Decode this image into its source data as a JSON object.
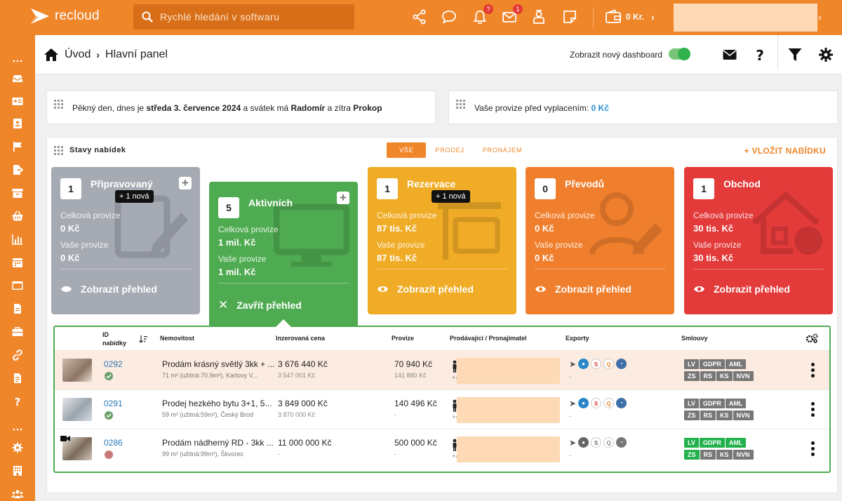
{
  "app": {
    "logo_text": "recloud"
  },
  "topbar": {
    "search_placeholder": "Rychlé hledání v softwaru",
    "notifications_count": "?",
    "messages_count": "1",
    "wallet_label": "0 Kr."
  },
  "header": {
    "breadcrumb_home": "Úvod",
    "breadcrumb_current": "Hlavní panel",
    "toggle_label": "Zobrazit nový dashboard"
  },
  "greeting": {
    "prefix": "Pěkný den, dnes je ",
    "date": "středa 3. července 2024",
    "middle": " a svátek má ",
    "today_name": "Radomír",
    "tomorrow_prefix": " a zítra ",
    "tomorrow_name": "Prokop"
  },
  "provision": {
    "label": "Vaše provize před vyplacením: ",
    "value": "0 Kč"
  },
  "offers": {
    "title": "Stavy nabídek",
    "tabs": [
      "VŠE",
      "PRODEJ",
      "PRONÁJEM"
    ],
    "add_label": "+ VLOŽIT NABÍDKU",
    "total_label": "Celková provize",
    "your_label": "Vaše provize",
    "show_label": "Zobrazit přehled",
    "close_label": "Zavřít přehled",
    "cards": [
      {
        "count": "1",
        "name": "Připravovaný",
        "new": "+ 1 nová",
        "total": "0 Kč",
        "yours": "0 Kč"
      },
      {
        "count": "5",
        "name": "Aktivních",
        "new": "",
        "total": "1 mil. Kč",
        "yours": "1 mil. Kč"
      },
      {
        "count": "1",
        "name": "Rezervace",
        "new": "+ 1 nová",
        "total": "87 tis. Kč",
        "yours": "87 tis. Kč"
      },
      {
        "count": "0",
        "name": "Převodů",
        "new": "",
        "total": "0 Kč",
        "yours": "0 Kč"
      },
      {
        "count": "1",
        "name": "Obchod",
        "new": "",
        "total": "30 tis. Kč",
        "yours": "30 tis. Kč"
      }
    ],
    "colors": {
      "prip": "#a6aab3",
      "akt": "#4fab51",
      "rez": "#f0ac26",
      "pre": "#f07f2d",
      "obc": "#e33a3a"
    }
  },
  "table": {
    "headers": {
      "id": "ID nabídky",
      "property": "Nemovitost",
      "price": "Inzerovaná cena",
      "provision": "Provize",
      "seller": "Prodávající / Pronajímatel",
      "exports": "Exporty",
      "contracts": "Smlouvy"
    },
    "rows": [
      {
        "id": "0292",
        "status": "ok",
        "title": "Prodám krásný světlý 3kk + ...",
        "sub": "71 m² (užitná:70.9m²), Karlovy V...",
        "price": "3 676 440 Kč",
        "price2": "3 547 001 Kč",
        "prov": "70 940 Kč",
        "prov2": "141 880 Kč",
        "phone": "+4",
        "export_dash": "-",
        "tags": [
          "LV",
          "GDPR",
          "AML",
          "ZS",
          "RS",
          "KS",
          "NVN"
        ],
        "green_tags": []
      },
      {
        "id": "0291",
        "status": "ok",
        "title": "Prodej hezkého bytu 3+1, 5...",
        "sub": "59 m² (užitná:59m²), Český Brod",
        "price": "3 849 000 Kč",
        "price2": "3 870 000 Kč",
        "prov": "140 496 Kč",
        "prov2": "-",
        "phone": "+4",
        "export_dash": "-",
        "tags": [
          "LV",
          "GDPR",
          "AML",
          "ZS",
          "RS",
          "KS",
          "NVN"
        ],
        "green_tags": []
      },
      {
        "id": "0286",
        "status": "bad",
        "title": "Prodám nádherný RD - 3kk ...",
        "sub": "99 m² (užitná:99m²), Škvorec",
        "price": "11 000 000 Kč",
        "price2": "-",
        "prov": "500 000 Kč",
        "prov2": "-",
        "phone": "+4",
        "export_dash": "-",
        "tags": [
          "LV",
          "GDPR",
          "AML",
          "ZS",
          "RS",
          "KS",
          "NVN"
        ],
        "green_tags": [
          "LV",
          "GDPR",
          "AML",
          "ZS"
        ]
      }
    ]
  }
}
